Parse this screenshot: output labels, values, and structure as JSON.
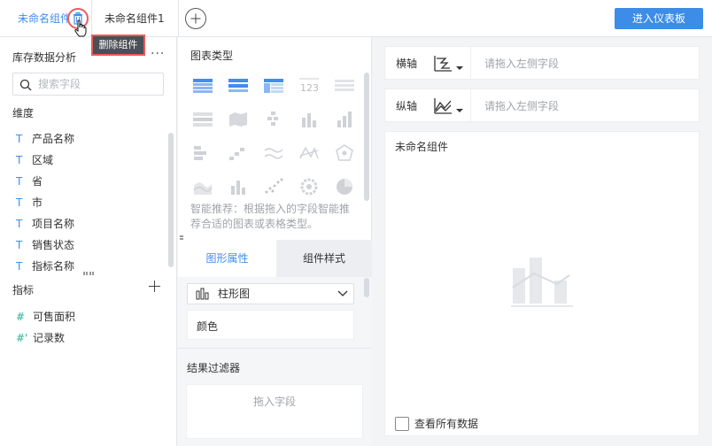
{
  "topbar": {
    "tabs": [
      {
        "label": "未命名组件",
        "active": true
      },
      {
        "label": "未命名组件1",
        "active": false
      }
    ],
    "enter_button": "进入仪表板",
    "tooltip": "删除组件"
  },
  "left": {
    "dataset_title": "库存数据分析",
    "more": "···",
    "search_placeholder": "搜索字段",
    "dimension_title": "维度",
    "dimensions": [
      "产品名称",
      "区域",
      "省",
      "市",
      "项目名称",
      "销售状态",
      "指标名称"
    ],
    "dimension_type_glyph": "T",
    "measure_title": "指标",
    "measures": [
      {
        "label": "可售面积",
        "glyph": "#"
      },
      {
        "label": "记录数",
        "glyph": "#'"
      }
    ]
  },
  "middle": {
    "chart_type_title": "图表类型",
    "recommend_text": "智能推荐：根据拖入的字段智能推荐合适的图表或表格类型。",
    "tabs": {
      "graph_props": "图形属性",
      "component_style": "组件样式"
    },
    "chart_select": "柱形图",
    "color_label": "颜色",
    "filter_title": "结果过滤器",
    "filter_drop": "拖入字段",
    "chart_icon_names": [
      "table-grouped",
      "table-detail",
      "table-cross",
      "kpi-number",
      "table-plain",
      "heatmap-table",
      "map-area",
      "dot-chart",
      "bar-chart",
      "stacked-column",
      "waterfall",
      "stepped-bar",
      "line-chart",
      "radar-chart",
      "polygon-chart",
      "area-chart",
      "stacked-bar",
      "scatter-chart",
      "sunburst-chart",
      "pie-chart"
    ]
  },
  "right": {
    "x_axis_label": "横轴",
    "y_axis_label": "纵轴",
    "drop_placeholder": "请拖入左侧字段",
    "component_title": "未命名组件",
    "view_all": "查看所有数据"
  },
  "colors": {
    "accent": "#3c8ce8",
    "highlight": "#e85c5c",
    "measure": "#2ab39a"
  }
}
